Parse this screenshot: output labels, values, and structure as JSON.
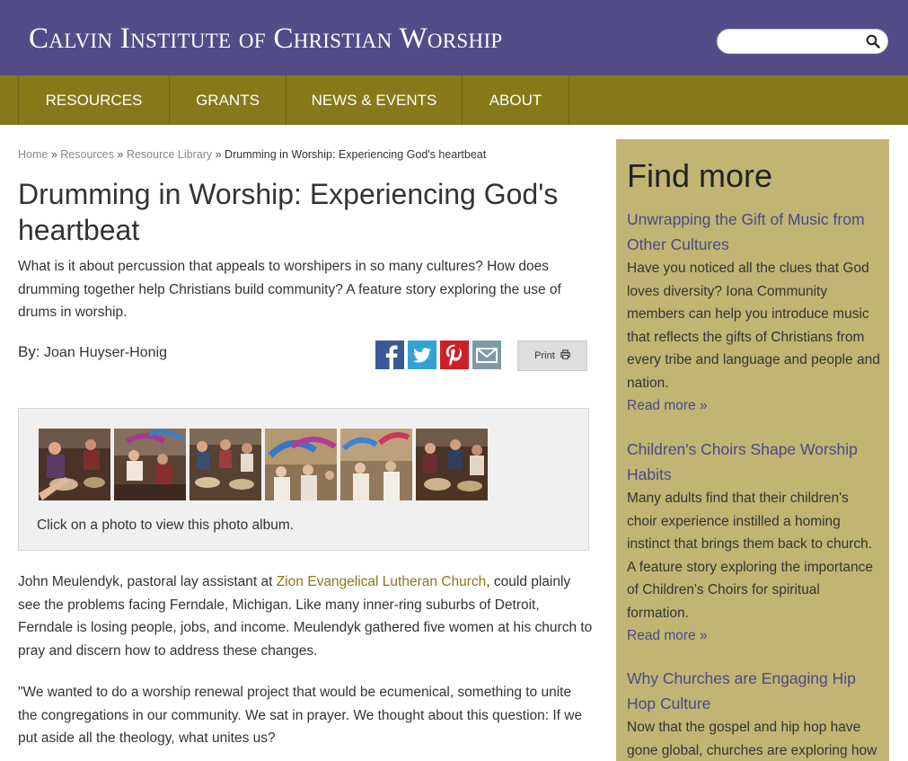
{
  "header": {
    "site_title": "Calvin Institute of Christian Worship",
    "search_placeholder": "",
    "colors": {
      "header_bg": "#524d88",
      "nav_bg": "#87791a",
      "sidebar_bg": "#c2b574",
      "link": "#4a4888"
    }
  },
  "nav": {
    "items": [
      {
        "label": "RESOURCES"
      },
      {
        "label": "GRANTS"
      },
      {
        "label": "NEWS & EVENTS"
      },
      {
        "label": "ABOUT"
      }
    ]
  },
  "breadcrumb": {
    "home": "Home",
    "resources": "Resources",
    "library": "Resource Library",
    "separator": "»",
    "current": "Drumming in Worship: Experiencing God's heartbeat"
  },
  "article": {
    "title": "Drumming in Worship: Experiencing God's heartbeat",
    "summary": "What is it about percussion that appeals to worshipers in so many cultures? How does drumming together help Christians build community? A feature story exploring the use of drums in worship.",
    "by_label": "By:",
    "author": "Joan Huyser-Honig",
    "print_label": "Print",
    "share_icons": [
      "facebook-icon",
      "twitter-icon",
      "pinterest-icon",
      "email-icon"
    ],
    "album_caption": "Click on a photo to view this photo album.",
    "para1_before": "John Meulendyk, pastoral lay assistant at ",
    "para1_link": "Zion Evangelical Lutheran Church",
    "para1_after": ", could plainly see the problems facing Ferndale, Michigan. Like many inner-ring suburbs of Detroit, Ferndale is losing people, jobs, and income. Meulendyk gathered five women at his church to pray and discern how to address these changes.",
    "para2": "\"We wanted to do a worship renewal project that would be ecumenical, something to unite the congregations in our community. We sat in prayer. We thought about this question: If we put aside all the theology, what unites us?"
  },
  "sidebar": {
    "heading": "Find more",
    "items": [
      {
        "title": "Unwrapping the Gift of Music from Other Cultures",
        "description": "Have you noticed all the clues that God loves diversity? Iona Community members can help you introduce music that reflects the gifts of Christians from every tribe and language and people and nation.",
        "more": "Read more »"
      },
      {
        "title": "Children's Choirs Shape Worship Habits",
        "description": "Many adults find that their children's choir experience instilled a homing instinct that brings them back to church. A feature story exploring the importance of Children's Choirs for spiritual formation.",
        "more": "Read more »"
      },
      {
        "title": "Why Churches are Engaging Hip Hop Culture",
        "description": "Now that the gospel and hip hop have gone global, churches are exploring how",
        "more": ""
      }
    ]
  }
}
